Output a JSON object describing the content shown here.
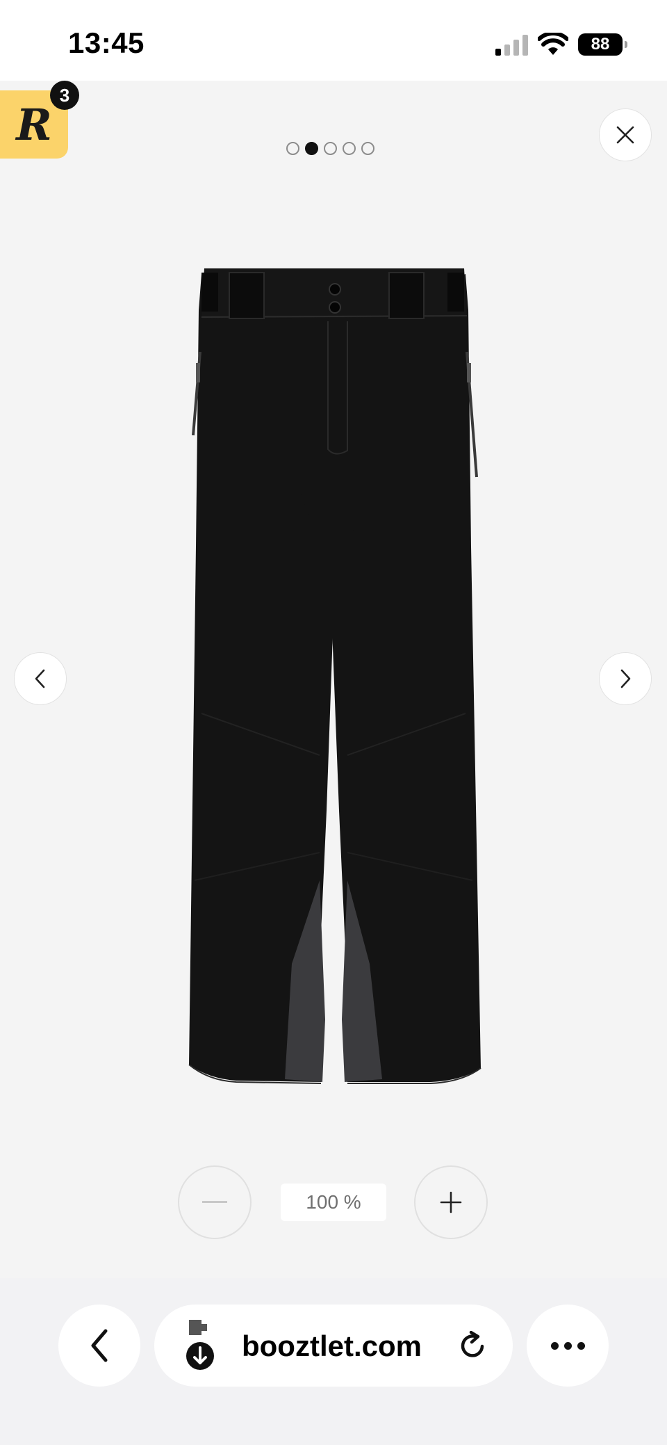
{
  "status_bar": {
    "time": "13:45",
    "battery_level": "88",
    "icons": [
      "cellular-signal-icon",
      "wifi-icon",
      "battery-icon"
    ]
  },
  "badge": {
    "logo_letter": "R",
    "count": "3",
    "color": "#fbd36a"
  },
  "gallery": {
    "pagination_total": 5,
    "pagination_active_index": 1,
    "product_image": "black-ski-pants",
    "icons": [
      "close-icon",
      "chevron-left-icon",
      "chevron-right-icon"
    ],
    "background_color": "#f4f4f4"
  },
  "zoom": {
    "level": "100 %",
    "icons": [
      "minus-icon",
      "plus-icon"
    ]
  },
  "browser": {
    "url": "booztlet.com",
    "icons": [
      "back-icon",
      "extension-download-icon",
      "reload-icon",
      "more-icon"
    ]
  }
}
